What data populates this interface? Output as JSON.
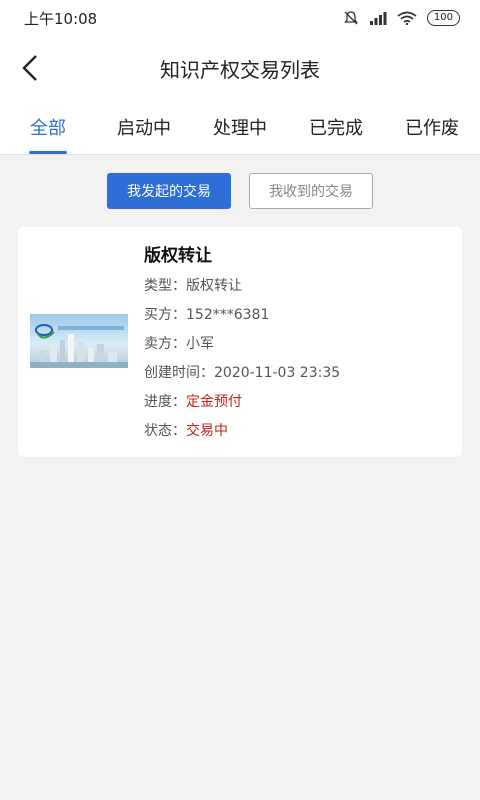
{
  "status_bar": {
    "time": "上午10:08",
    "battery": "100"
  },
  "header": {
    "title": "知识产权交易列表"
  },
  "tabs": [
    {
      "label": "全部",
      "active": true
    },
    {
      "label": "启动中",
      "active": false
    },
    {
      "label": "处理中",
      "active": false
    },
    {
      "label": "已完成",
      "active": false
    },
    {
      "label": "已作废",
      "active": false
    }
  ],
  "switch": {
    "initiated": "我发起的交易",
    "received": "我收到的交易"
  },
  "transaction": {
    "title": "版权转让",
    "type_label": "类型：",
    "type_value": "版权转让",
    "buyer_label": "买方：",
    "buyer_value": "152***6381",
    "seller_label": "卖方：",
    "seller_value": "小军",
    "created_label": "创建时间：",
    "created_value": "2020-11-03 23:35",
    "progress_label": "进度：",
    "progress_value": "定金预付",
    "status_label": "状态：",
    "status_value": "交易中",
    "thumb_logo": "GBAIP 粤港澳大湾区知识产权交易博览会"
  },
  "colors": {
    "accent": "#2d6fd6",
    "status_red": "#c4231e"
  }
}
